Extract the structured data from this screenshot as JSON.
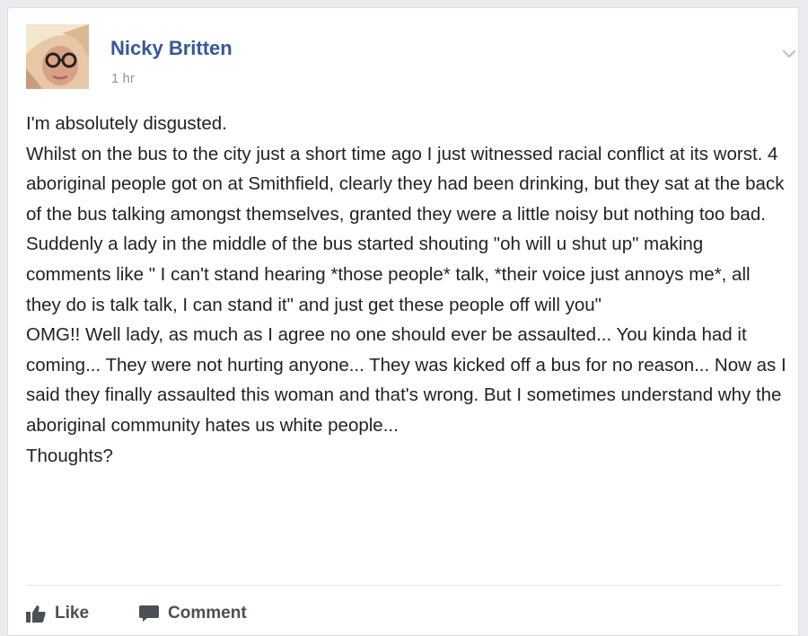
{
  "post": {
    "author": "Nicky Britten",
    "timestamp": "1 hr",
    "paragraphs": [
      "I'm absolutely disgusted.",
      "Whilst on the bus to the city just a short time ago I just witnessed racial conflict at its worst. 4 aboriginal people got on at Smithfield, clearly they had been drinking, but they sat at the back of the bus talking amongst themselves, granted they were a little noisy but nothing too bad. Suddenly a lady in the middle of the bus started shouting \"oh will u shut up\" making comments like \" I can't stand hearing *those people* talk, *their voice just annoys me*, all they do is talk talk, I can stand it\" and just get these people off will you\"",
      "OMG!! Well lady, as much as I agree no one should ever be assaulted... You kinda had it coming... They were not hurting anyone... They was kicked off a bus for no reason... Now as I said they finally assaulted this woman and that's wrong. But I sometimes understand why the aboriginal community hates us white people...",
      "Thoughts?"
    ]
  },
  "actions": {
    "like_label": "Like",
    "comment_label": "Comment"
  },
  "icons": {
    "menu": "chevron-down-icon",
    "like": "thumbs-up-icon",
    "comment": "speech-bubble-icon"
  },
  "colors": {
    "author_link": "#365899",
    "text": "#1d2129",
    "meta": "#90949c",
    "action": "#4b4f56"
  }
}
